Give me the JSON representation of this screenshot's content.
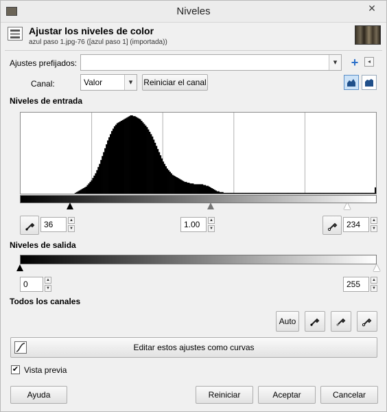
{
  "window": {
    "title": "Niveles",
    "close_glyph": "✕"
  },
  "header": {
    "title": "Ajustar los niveles de color",
    "subtitle": "azul paso 1.jpg-76 ([azul paso 1] (importada))"
  },
  "presets": {
    "label": "Ajustes prefijados:",
    "value": "",
    "add_icon": "plus-icon",
    "menu_icon": "menu-icon"
  },
  "channel": {
    "label": "Canal:",
    "value": "Valor",
    "reset_label": "Reiniciar el canal"
  },
  "input_levels": {
    "heading": "Niveles de entrada",
    "black_point": "36",
    "gamma": "1.00",
    "white_point": "234",
    "black_fraction": 0.141,
    "gamma_fraction": 0.535,
    "white_fraction": 0.918
  },
  "output_levels": {
    "heading": "Niveles de salida",
    "low": "0",
    "high": "255",
    "low_fraction": 0.0,
    "high_fraction": 1.0
  },
  "all_channels": {
    "heading": "Todos los canales",
    "auto_label": "Auto"
  },
  "curves_button": {
    "label": "Editar estos ajustes como curvas"
  },
  "preview": {
    "label": "Vista previa",
    "checked": true
  },
  "buttons": {
    "help": "Ayuda",
    "reset": "Reiniciar",
    "accept": "Aceptar",
    "cancel": "Cancelar"
  },
  "histogram": {
    "bins": [
      0,
      0,
      0,
      0,
      0,
      0,
      0,
      0,
      0,
      0,
      0,
      0,
      0,
      0,
      0,
      0,
      0,
      0,
      0,
      0,
      0,
      0,
      0,
      0,
      0,
      0,
      0,
      0,
      0,
      0,
      0,
      0,
      0,
      0,
      0,
      0,
      0,
      0,
      0,
      0,
      1,
      2,
      3,
      4,
      5,
      6,
      7,
      8,
      9,
      11,
      13,
      15,
      17,
      20,
      23,
      26,
      30,
      34,
      38,
      43,
      48,
      53,
      58,
      63,
      68,
      72,
      76,
      80,
      83,
      86,
      88,
      90,
      91,
      92,
      93,
      94,
      95,
      96,
      97,
      98,
      99,
      100,
      100,
      99,
      99,
      98,
      97,
      96,
      95,
      93,
      91,
      89,
      87,
      85,
      82,
      79,
      76,
      73,
      69,
      65,
      61,
      57,
      53,
      49,
      45,
      41,
      38,
      35,
      32,
      30,
      28,
      26,
      24,
      23,
      22,
      21,
      20,
      19,
      18,
      17,
      16,
      15,
      15,
      14,
      14,
      13,
      13,
      13,
      12,
      12,
      12,
      12,
      12,
      12,
      12,
      11,
      11,
      10,
      10,
      9,
      8,
      7,
      6,
      5,
      4,
      3,
      3,
      2,
      2,
      2,
      1,
      1,
      1,
      1,
      1,
      1,
      1,
      1,
      1,
      1,
      1,
      1,
      1,
      1,
      1,
      1,
      1,
      1,
      1,
      1,
      1,
      1,
      1,
      1,
      1,
      1,
      1,
      1,
      1,
      1,
      1,
      1,
      1,
      1,
      1,
      1,
      1,
      1,
      1,
      1,
      1,
      1,
      1,
      1,
      1,
      1,
      1,
      1,
      1,
      1,
      1,
      1,
      1,
      1,
      1,
      1,
      1,
      1,
      1,
      1,
      1,
      1,
      1,
      1,
      1,
      1,
      1,
      1,
      1,
      1,
      1,
      1,
      1,
      1,
      1,
      1,
      1,
      1,
      1,
      1,
      1,
      1,
      1,
      1,
      1,
      1,
      1,
      1,
      1,
      1,
      1,
      1,
      1,
      1,
      1,
      1,
      1,
      1,
      1,
      1,
      1,
      1,
      1,
      1,
      1,
      1,
      1,
      1,
      1,
      1,
      1,
      1,
      8
    ]
  }
}
